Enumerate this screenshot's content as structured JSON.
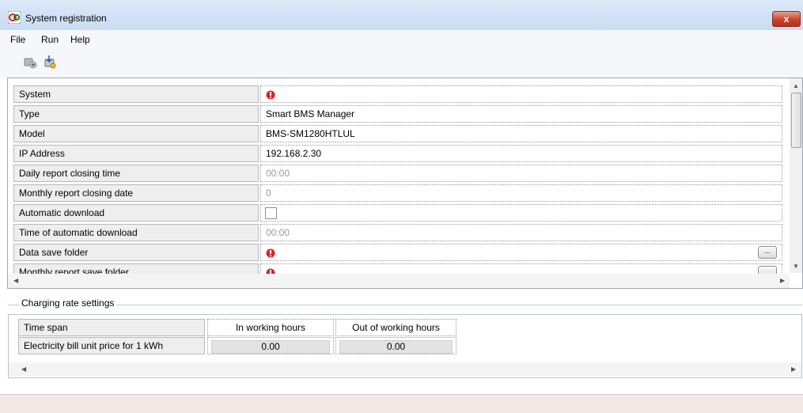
{
  "window": {
    "title": "System registration",
    "close_label": "x"
  },
  "menu": {
    "items": [
      "File",
      "Run",
      "Help"
    ]
  },
  "properties": [
    {
      "label": "System",
      "value": "",
      "state": "error"
    },
    {
      "label": "Type",
      "value": "Smart BMS Manager",
      "state": "normal"
    },
    {
      "label": "Model",
      "value": "BMS-SM1280HTLUL",
      "state": "normal"
    },
    {
      "label": "IP Address",
      "value": "192.168.2.30",
      "state": "normal"
    },
    {
      "label": "Daily report closing time",
      "value": "00:00",
      "state": "disabled"
    },
    {
      "label": "Monthly report closing date",
      "value": "0",
      "state": "disabled"
    },
    {
      "label": "Automatic download",
      "value": "",
      "state": "checkbox",
      "checked": false
    },
    {
      "label": "Time of automatic download",
      "value": "00:00",
      "state": "disabled"
    },
    {
      "label": "Data save folder",
      "value": "",
      "state": "error",
      "browse_label": "..."
    },
    {
      "label": "Monthly report save folder",
      "value": "",
      "state": "error"
    }
  ],
  "charging": {
    "group_label": "Charging rate settings",
    "header_label": "Time span",
    "row_label": "Electricity bill unit price for 1 kWh",
    "columns": [
      "In working hours",
      "Out of working hours"
    ],
    "values": [
      "0.00",
      "0.00"
    ]
  },
  "colors": {
    "error": "#e02020",
    "accent_close": "#c7432a"
  }
}
